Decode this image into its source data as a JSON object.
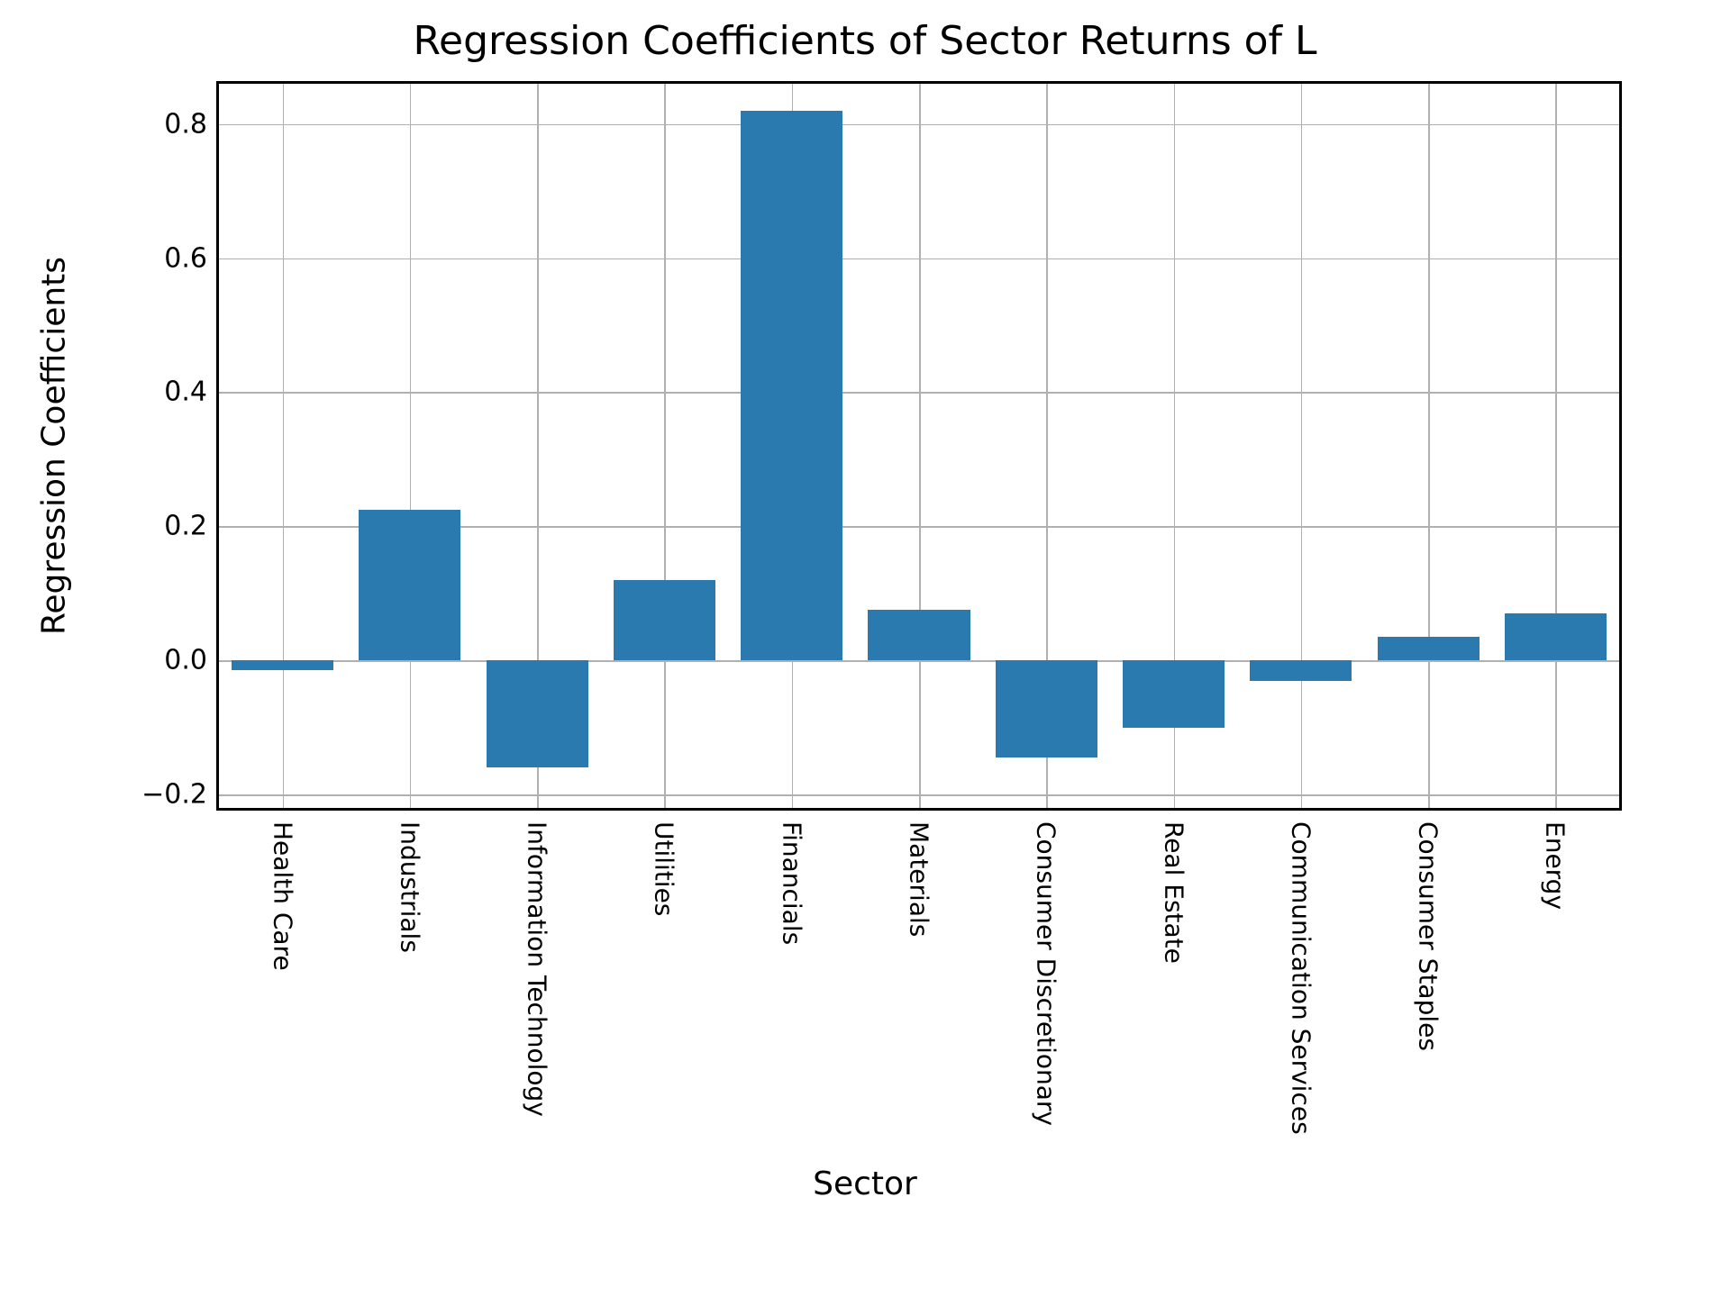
{
  "chart_data": {
    "type": "bar",
    "title": "Regression Coefficients of Sector Returns of L",
    "xlabel": "Sector",
    "ylabel": "Regression Coefficients",
    "categories": [
      "Health Care",
      "Industrials",
      "Information Technology",
      "Utilities",
      "Financials",
      "Materials",
      "Consumer Discretionary",
      "Real Estate",
      "Communication Services",
      "Consumer Staples",
      "Energy"
    ],
    "values": [
      -0.015,
      0.225,
      -0.16,
      0.12,
      0.82,
      0.075,
      -0.145,
      -0.1,
      -0.03,
      0.035,
      0.07
    ],
    "ylim": [
      -0.22,
      0.86
    ],
    "yticks": [
      -0.2,
      0.0,
      0.2,
      0.4,
      0.6,
      0.8
    ],
    "ytick_labels": [
      "−0.2",
      "0.0",
      "0.2",
      "0.4",
      "0.6",
      "0.8"
    ],
    "bar_color": "#2a7ab0",
    "bar_width_frac": 0.8,
    "grid": true
  }
}
